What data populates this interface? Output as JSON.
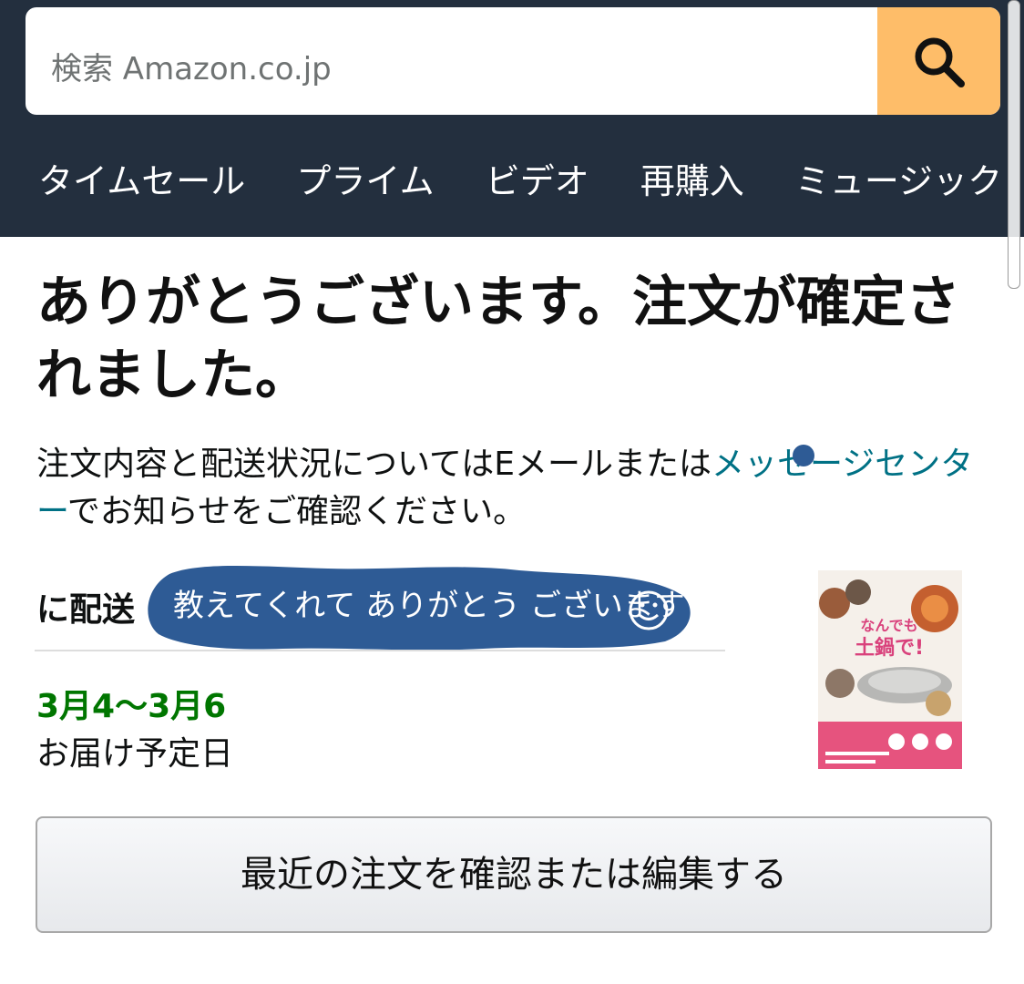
{
  "search": {
    "placeholder": "検索 Amazon.co.jp"
  },
  "nav": {
    "items": [
      {
        "label": "タイムセール"
      },
      {
        "label": "プライム"
      },
      {
        "label": "ビデオ"
      },
      {
        "label": "再購入"
      },
      {
        "label": "ミュージック"
      }
    ]
  },
  "main": {
    "title": "ありがとうございます。注文が確定されました。",
    "info_text": "注文内容と配送状況についてはEメールまたは",
    "info_link": "メッセージセンター",
    "info_suffix": "でお知らせをご確認ください。",
    "delivery_heading": "に配送",
    "annotation": "教えてくれて ありがとう ございます",
    "delivery_date": "3月4〜3月6",
    "delivery_date_label": "お届け予定日",
    "book_cover_text": "なんでも土鍋で!",
    "order_button": "最近の注文を確認または編集する"
  },
  "colors": {
    "header_bg": "#232f3e",
    "search_button": "#febd69",
    "link": "#007185",
    "date_green": "#007600",
    "annotation_blue": "#2e5b95"
  }
}
